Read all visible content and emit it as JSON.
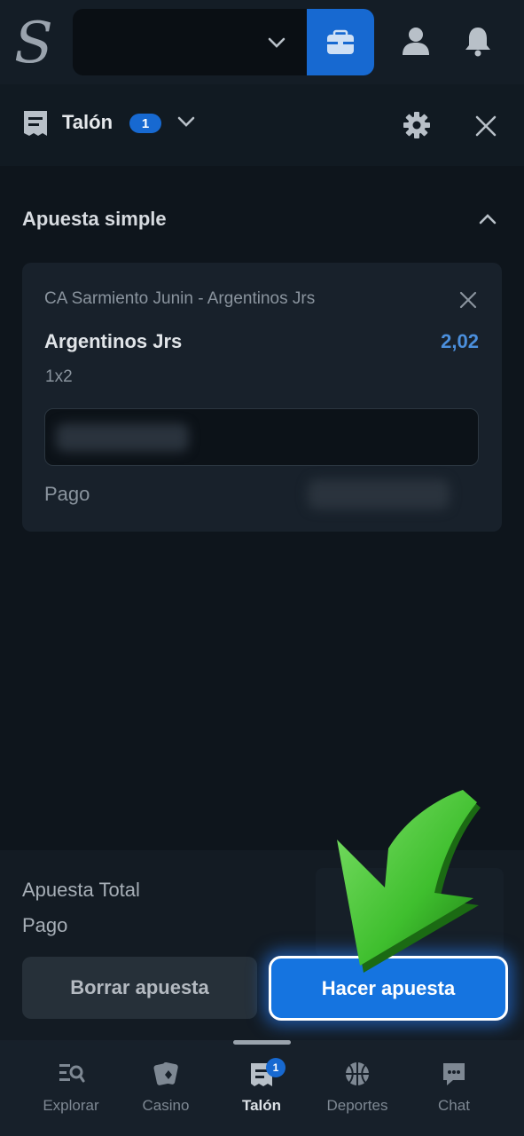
{
  "header": {
    "logo_letter": "S",
    "balance_value": "",
    "icons": [
      "chevron-down-icon",
      "wallet-icon",
      "user-icon",
      "bell-icon"
    ]
  },
  "slip": {
    "title": "Talón",
    "count": "1"
  },
  "section": {
    "title": "Apuesta simple"
  },
  "bet": {
    "match": "CA Sarmiento Junin - Argentinos Jrs",
    "selection": "Argentinos Jrs",
    "odds": "2,02",
    "market": "1x2",
    "stake": "",
    "payout_label": "Pago"
  },
  "summary": {
    "total_label": "Apuesta Total",
    "pay_label": "Pago",
    "clear_button": "Borrar apuesta",
    "place_button": "Hacer apuesta"
  },
  "nav": {
    "items": [
      {
        "label": "Explorar"
      },
      {
        "label": "Casino"
      },
      {
        "label": "Talón",
        "badge": "1"
      },
      {
        "label": "Deportes"
      },
      {
        "label": "Chat"
      }
    ]
  },
  "colors": {
    "accent": "#1769d1",
    "odds": "#4b8fdc",
    "arrow": "#3fbf2e"
  }
}
